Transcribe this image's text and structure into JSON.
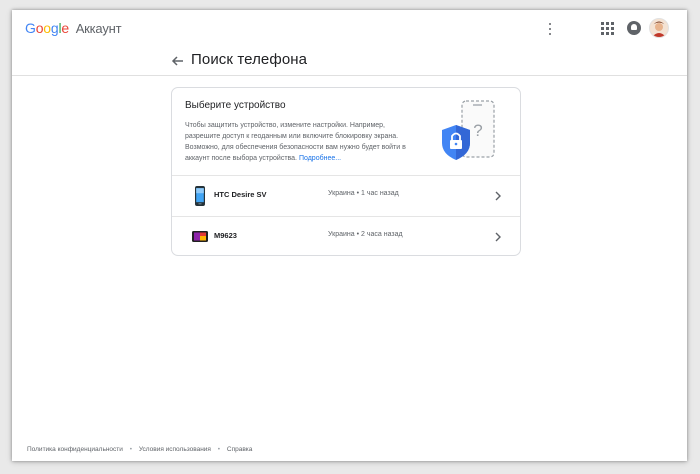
{
  "topbar": {
    "logo": {
      "g1": "G",
      "g2": "o",
      "g3": "o",
      "g4": "g",
      "g5": "l",
      "g6": "e"
    },
    "product": "Аккаунт"
  },
  "header": {
    "title": "Поиск телефона"
  },
  "card": {
    "title": "Выберите устройство",
    "description": "Чтобы защитить устройство, измените настройки. Например, разрешите доступ к геоданным или включите блокировку экрана. Возможно, для обеспечения безопасности вам нужно будет войти в аккаунт после выбора устройства.",
    "learn_more": "Подробнее..."
  },
  "devices": [
    {
      "name": "HTC Desire SV",
      "meta": "Украина • 1 час назад",
      "icon": "phone-icon"
    },
    {
      "name": "M9623",
      "meta": "Украина • 2 часа назад",
      "icon": "tablet-icon"
    }
  ],
  "footer": {
    "privacy": "Политика конфиденциальности",
    "terms": "Условия использования",
    "help": "Справка",
    "separator": "•"
  },
  "colors": {
    "accent": "#1a73e8",
    "shield": "#4285F4",
    "text_primary": "#202124",
    "text_secondary": "#5f6368"
  }
}
